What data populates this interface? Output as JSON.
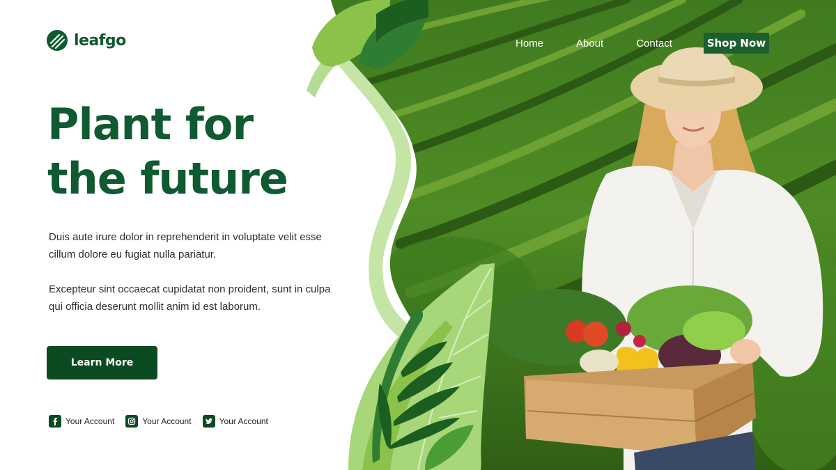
{
  "brand": {
    "name": "leafgo",
    "logo_icon": "leaf-stripes-logo",
    "color": "#0f5a30"
  },
  "nav": {
    "items": [
      {
        "label": "Home"
      },
      {
        "label": "About"
      },
      {
        "label": "Contact"
      }
    ],
    "cta_label": "Shop Now"
  },
  "hero": {
    "headline_line1": "Plant for",
    "headline_line2": "the future",
    "paragraph1": "Duis aute irure dolor in reprehenderit in voluptate velit esse cillum dolore eu fugiat nulla pariatur.",
    "paragraph2": "Excepteur sint occaecat cupidatat non proident, sunt in culpa qui officia deserunt mollit anim id est laborum.",
    "button_label": "Learn More",
    "image": "woman-holding-vegetable-crate-in-field"
  },
  "socials": [
    {
      "icon": "facebook-icon",
      "label": "Your Account"
    },
    {
      "icon": "instagram-icon",
      "label": "Your Account"
    },
    {
      "icon": "twitter-icon",
      "label": "Your Account"
    }
  ],
  "colors": {
    "primary": "#0f5a30",
    "button": "#0c4a22",
    "accent_light": "#c5e5a6",
    "accent_mid": "#8bc34a"
  }
}
